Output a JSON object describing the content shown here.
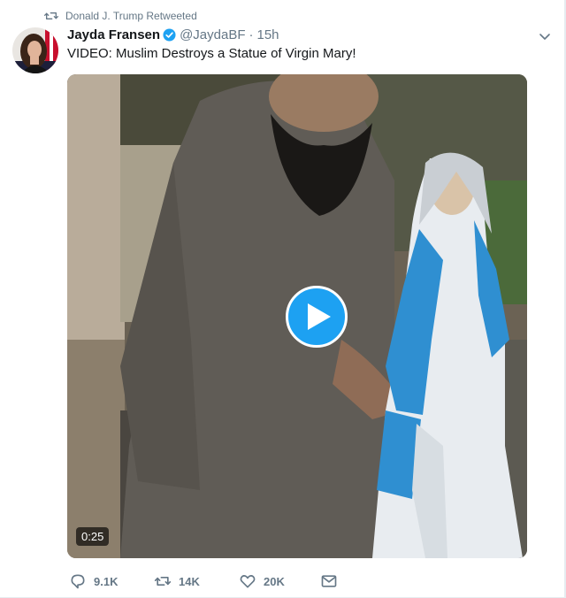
{
  "retweet_context": {
    "text": "Donald J. Trump Retweeted"
  },
  "tweet": {
    "author_name": "Jayda Fransen",
    "author_handle": "@JaydaBF",
    "separator": "·",
    "timestamp": "15h",
    "text": "VIDEO: Muslim Destroys a Statue of Virgin Mary!"
  },
  "media": {
    "type": "video",
    "duration": "0:25"
  },
  "actions": {
    "replies": "9.1K",
    "retweets": "14K",
    "likes": "20K"
  },
  "colors": {
    "accent": "#1da1f2",
    "muted_text": "#657786",
    "primary_text": "#14171a"
  },
  "icons": {
    "retweet_context": "retweet-icon",
    "verified": "verified-badge-icon",
    "menu": "chevron-down-icon",
    "play": "play-icon",
    "reply": "reply-icon",
    "retweet": "retweet-icon",
    "like": "heart-icon",
    "message": "envelope-icon"
  }
}
